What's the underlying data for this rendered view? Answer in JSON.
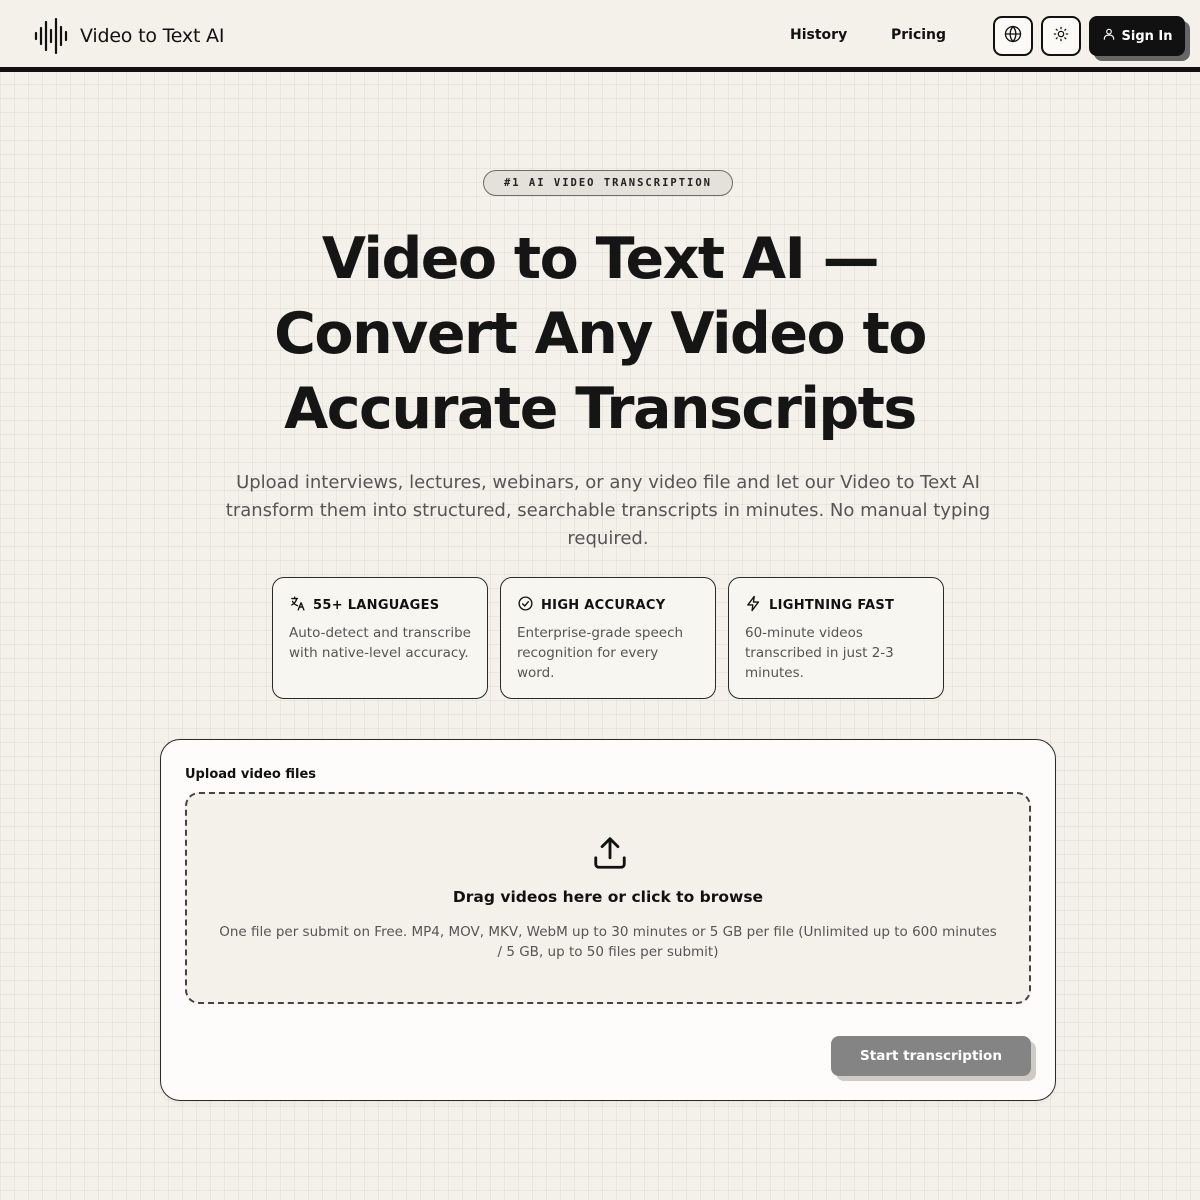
{
  "header": {
    "logo_text": "Video to Text AI",
    "nav": {
      "history": "History",
      "pricing": "Pricing"
    },
    "sign_in": "Sign In"
  },
  "hero": {
    "badge": "#1 AI VIDEO TRANSCRIPTION",
    "title": "Video to Text AI — Convert Any Video to Accurate Transcripts",
    "subtitle": "Upload interviews, lectures, webinars, or any video file and let our Video to Text AI transform them into structured, searchable transcripts in minutes. No manual typing required."
  },
  "features": [
    {
      "icon": "translate-icon",
      "title": "55+ LANGUAGES",
      "desc": "Auto-detect and transcribe with native-level accuracy."
    },
    {
      "icon": "check-circle-icon",
      "title": "HIGH ACCURACY",
      "desc": "Enterprise-grade speech recognition for every word."
    },
    {
      "icon": "lightning-icon",
      "title": "LIGHTNING FAST",
      "desc": "60-minute videos transcribed in just 2-3 minutes."
    }
  ],
  "upload": {
    "label": "Upload video files",
    "drop_title": "Drag videos here or click to browse",
    "drop_hint": "One file per submit on Free. MP4, MOV, MKV, WebM up to 30 minutes or 5 GB per file (Unlimited up to 600 minutes / 5 GB, up to 50 files per submit)",
    "start_button": "Start transcription"
  },
  "colors": {
    "background": "#f4f1ea",
    "ink": "#111111",
    "muted_text": "#555555",
    "disabled_button": "#848484"
  }
}
